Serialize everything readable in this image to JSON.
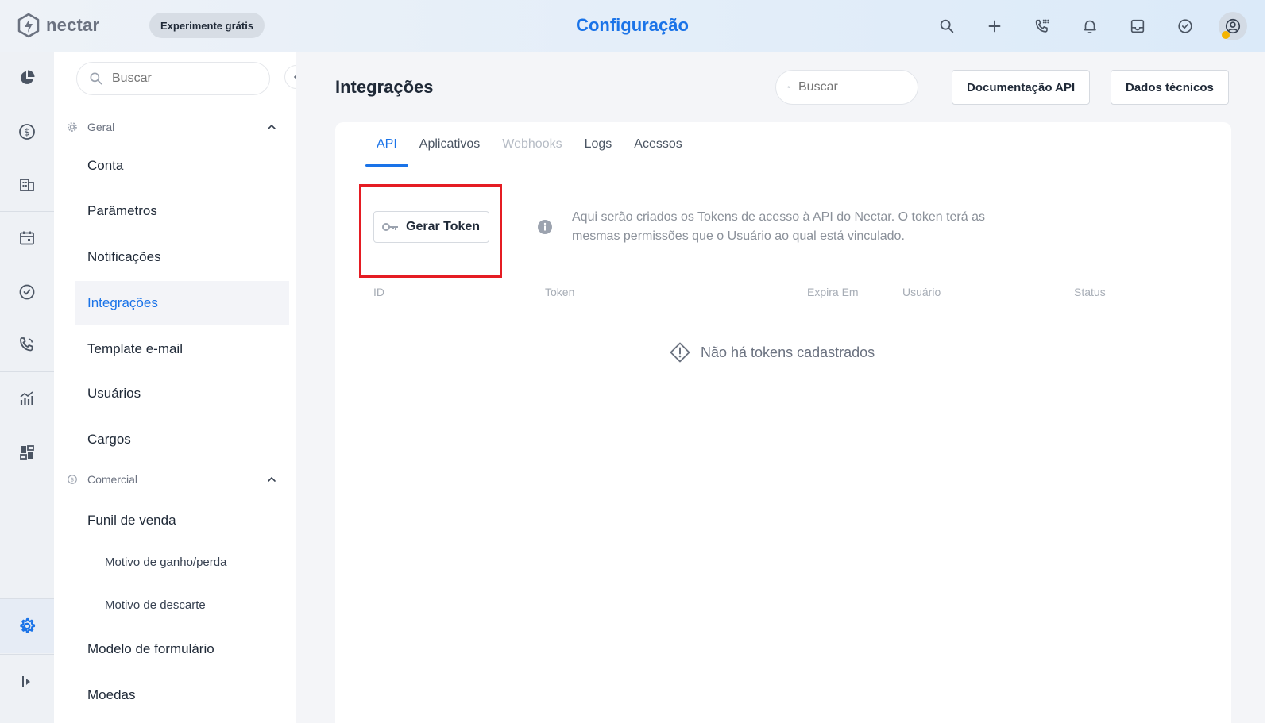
{
  "topbar": {
    "brand": "nectar",
    "trial_label": "Experimente grátis",
    "page_title": "Configuração"
  },
  "sidebar": {
    "search_placeholder": "Buscar",
    "sections": {
      "geral": "Geral",
      "comercial": "Comercial"
    },
    "items": {
      "conta": "Conta",
      "parametros": "Parâmetros",
      "notificacoes": "Notificações",
      "integracoes": "Integrações",
      "template": "Template e-mail",
      "usuarios": "Usuários",
      "cargos": "Cargos",
      "funil": "Funil de venda",
      "motivo_ganho": "Motivo de ganho/perda",
      "motivo_descarte": "Motivo de descarte",
      "modelo_form": "Modelo de formulário",
      "moedas": "Moedas"
    }
  },
  "main": {
    "title": "Integrações",
    "search_placeholder": "Buscar",
    "doc_button": "Documentação API",
    "tech_button": "Dados técnicos",
    "tabs": {
      "api": "API",
      "aplicativos": "Aplicativos",
      "webhooks": "Webhooks",
      "logs": "Logs",
      "acessos": "Acessos"
    },
    "generate_token": "Gerar Token",
    "info_text": "Aqui serão criados os Tokens de acesso à API do Nectar. O token terá as mesmas permissões que o Usuário ao qual está vinculado.",
    "columns": {
      "id": "ID",
      "token": "Token",
      "expira": "Expira Em",
      "usuario": "Usuário",
      "status": "Status"
    },
    "empty_message": "Não há tokens cadastrados"
  },
  "colors": {
    "accent": "#1a73e8",
    "highlight": "#e51c23"
  }
}
